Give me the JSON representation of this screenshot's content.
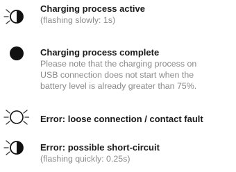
{
  "legend": [
    {
      "icon": "half-filled-circle-flashing-icon",
      "title": "Charging process active",
      "details": [
        "(flashing slowly: 1s)"
      ]
    },
    {
      "icon": "filled-circle-icon",
      "title": "Charging process complete",
      "details": [
        "Please note that the charging process on",
        "USB connection does not start when the",
        "battery level is already greater than 75%."
      ]
    },
    {
      "icon": "empty-circle-flashing-icon",
      "title": "Error: loose connection / contact fault",
      "details": []
    },
    {
      "icon": "half-filled-circle-flashing-icon",
      "title": "Error: possible short-circuit",
      "details": [
        "(flashing quickly: 0.25s)"
      ]
    }
  ],
  "colors": {
    "led": "#111111",
    "text": "#1a1a1a",
    "muted": "#8a8a8a",
    "ray": "#333333"
  }
}
